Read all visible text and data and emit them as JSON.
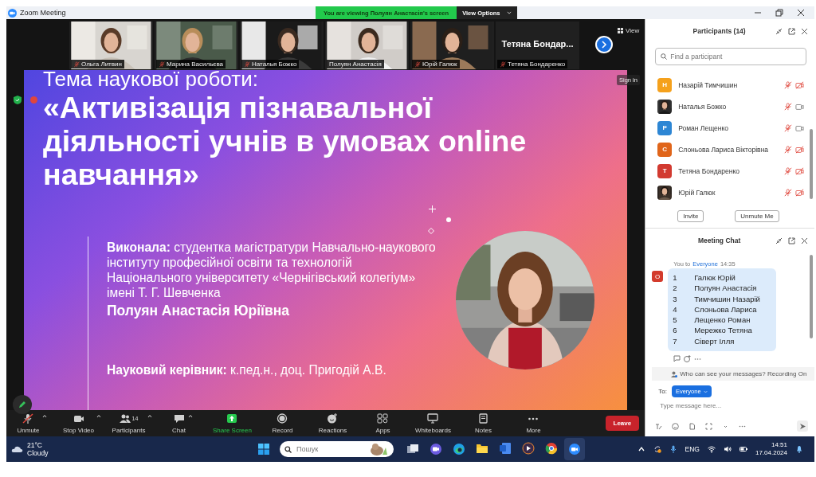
{
  "window": {
    "title": "Zoom Meeting"
  },
  "share_banner": {
    "text": "You are viewing Полуян Анастасія's screen",
    "button": "View Options"
  },
  "gallery": {
    "view_button": "View",
    "tiles": [
      {
        "kind": "video",
        "name": "Ольга Литвин",
        "muted": true
      },
      {
        "kind": "video",
        "name": "Марина Васильєва",
        "muted": true
      },
      {
        "kind": "video",
        "name": "Наталья Божко",
        "muted": true
      },
      {
        "kind": "video",
        "name": "Полуян Анастасія",
        "muted": false
      },
      {
        "kind": "video",
        "name": "Юрій Галюк",
        "muted": true
      },
      {
        "kind": "name",
        "display_name": "Тетяна Бондар...",
        "name": "Тетяна Бондаренко",
        "muted": true
      }
    ]
  },
  "slide": {
    "sign_in": "Sign in",
    "heading": "Тема наукової роботи:",
    "title_lines": [
      "«Активізація пізнавальної",
      "діяльності учнів в умовах online",
      "навчання»"
    ],
    "author_info": "**Виконала:** студентка магістратури Навчально-наукового інституту професійної освіти та технологій Національного університету «Чернігівський колегіум» імені Т. Г. Шевченка",
    "author_name": "Полуян Анастасія Юріївна",
    "supervisor": "**Науковий керівник:** к.пед.н., доц. Пригодій А.В."
  },
  "toolbar": {
    "leave": "Leave",
    "items": [
      {
        "kind": "mic",
        "label": "Unmute",
        "muted": true,
        "caret": true
      },
      {
        "kind": "camera",
        "label": "Stop Video",
        "caret": true
      },
      {
        "kind": "people",
        "label": "Participants",
        "count": "14",
        "caret": true
      },
      {
        "kind": "chat",
        "label": "Chat",
        "caret": true
      },
      {
        "kind": "share",
        "label": "Share Screen",
        "caret": false
      },
      {
        "kind": "record",
        "label": "Record",
        "caret": false
      },
      {
        "kind": "reactions",
        "label": "Reactions",
        "caret": false
      },
      {
        "kind": "apps",
        "label": "Apps",
        "caret": false
      },
      {
        "kind": "whiteboard",
        "label": "Whiteboards",
        "caret": false
      },
      {
        "kind": "notes",
        "label": "Notes",
        "caret": false
      },
      {
        "kind": "more",
        "label": "More",
        "caret": false
      }
    ]
  },
  "participants_panel": {
    "title": "Participants (14)",
    "search_placeholder": "Find a participant",
    "buttons": [
      "Invite",
      "Unmute Me"
    ],
    "participants": [
      {
        "name": "Назарій Тимчишин",
        "kind": "letter",
        "initial": "Н",
        "color": "#f5a11c",
        "muted": true,
        "video_off": true
      },
      {
        "name": "Наталья Божко",
        "muted": true,
        "video_off": false
      },
      {
        "name": "Роман Лещенко",
        "kind": "letter",
        "initial": "Р",
        "color": "#2d86d4",
        "muted": true,
        "video_off": false
      },
      {
        "name": "Слоньова Лариса Вікторівна",
        "kind": "letter",
        "initial": "С",
        "color": "#e0651a",
        "muted": true,
        "video_off": true
      },
      {
        "name": "Тетяна Бондаренко",
        "kind": "letter",
        "initial": "Т",
        "color": "#d23a30",
        "muted": true,
        "video_off": true
      },
      {
        "name": "Юрій Галюк",
        "muted": true,
        "video_off": true
      }
    ]
  },
  "chat": {
    "title": "Meeting Chat",
    "notice": "Who can see your messages? Recording On",
    "to_label": "To:",
    "to_value": "Everyone",
    "placeholder": "Type message here...",
    "message": {
      "sender": "You to",
      "recipient": "Everyone",
      "time": "14:35",
      "initial": "О",
      "rows": [
        {
          "number": "1",
          "name": "Галюк Юрій"
        },
        {
          "number": "2",
          "name": "Полуян Анастасія"
        },
        {
          "number": "3",
          "name": "Тимчишин Назарій"
        },
        {
          "number": "4",
          "name": "Слоньова Лариса"
        },
        {
          "number": "5",
          "name": "Лещенко Роман"
        },
        {
          "number": "6",
          "name": "Мережко Тетяна"
        },
        {
          "number": "7",
          "name": "Сіверт Ілля"
        }
      ]
    }
  },
  "taskbar": {
    "temperature": "21°C",
    "condition": "Cloudy",
    "search_placeholder": "Пошук",
    "language": "ENG",
    "time": "14:51",
    "date": "17.04.2024"
  }
}
